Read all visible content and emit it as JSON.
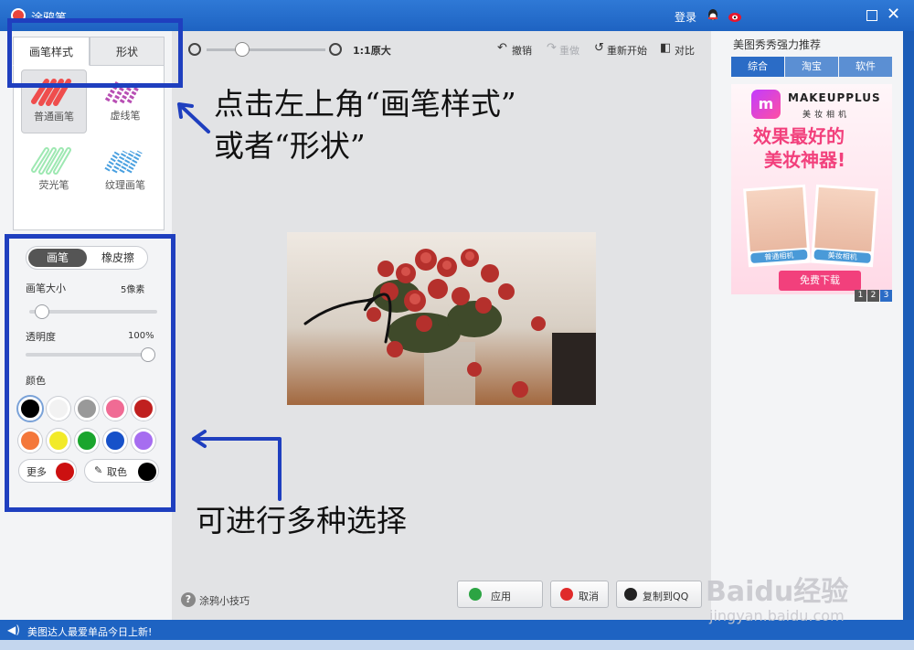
{
  "window": {
    "title": "涂鸦笔",
    "login": "登录"
  },
  "left_panel": {
    "tabs": [
      {
        "label": "画笔样式",
        "active": true
      },
      {
        "label": "形状",
        "active": false
      }
    ],
    "brushes": [
      {
        "label": "普通画笔",
        "selected": true
      },
      {
        "label": "虚线笔",
        "selected": false
      },
      {
        "label": "荧光笔",
        "selected": false
      },
      {
        "label": "纹理画笔",
        "selected": false
      }
    ],
    "mode": {
      "brush": "画笔",
      "eraser": "橡皮擦"
    },
    "size": {
      "label": "画笔大小",
      "value": "5像素",
      "level": 0.05
    },
    "opacity": {
      "label": "透明度",
      "value": "100%",
      "level": 1.0
    },
    "color_label": "颜色",
    "colors": [
      "#000000",
      "#f2f2f2",
      "#999999",
      "#f06b94",
      "#c0201f",
      "#f4773a",
      "#f2ea28",
      "#1aa52d",
      "#1751c9",
      "#a66df0"
    ],
    "more": "更多",
    "more_color": "#cc1010",
    "picker": "取色",
    "picker_color": "#000000"
  },
  "toolbar": {
    "zoom_level": 0.27,
    "actual_size": "1:1原大",
    "undo": "撤销",
    "redo": "重做",
    "restart": "重新开始",
    "compare": "对比"
  },
  "bottom": {
    "tips": "涂鸦小技巧",
    "apply": "应用",
    "cancel": "取消",
    "copy_to_qq": "复制到QQ"
  },
  "right_panel": {
    "title": "美图秀秀强力推荐",
    "tabs": [
      {
        "label": "综合",
        "active": true
      },
      {
        "label": "淘宝",
        "active": false
      },
      {
        "label": "软件",
        "active": false
      }
    ],
    "ad": {
      "brand": "MAKEUPPLUS",
      "brand_cn": "美妆相机",
      "slogan_1": "效果最好的",
      "slogan_2": "美妆神器!",
      "face_left": "普通相机",
      "face_right": "美妆相机",
      "cta": "免费下载"
    },
    "pages": [
      "1",
      "2",
      "3"
    ],
    "active_page": "3"
  },
  "statusbar": {
    "text": "美图达人最爱单品今日上新!"
  },
  "annotations": {
    "top": "点击左上角“画笔样式”",
    "top_2": "或者“形状”",
    "bottom": "可进行多种选择"
  },
  "watermark": {
    "brand": "Baidu经验",
    "url": "jingyan.baidu.com"
  },
  "colors": {
    "titlebar": "#2f79d6",
    "annotation": "#1f3fbf",
    "accent_pink": "#f2407c"
  }
}
